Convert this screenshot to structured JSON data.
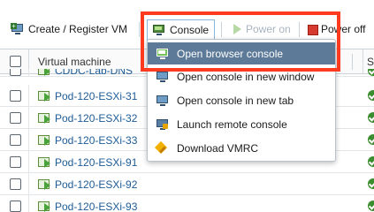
{
  "toolbar": {
    "create_label": "Create / Register VM",
    "console_label": "Console",
    "power_on_label": "Power on",
    "power_off_label": "Power off"
  },
  "grid": {
    "columns": {
      "vm": "Virtual machine",
      "status": "S"
    },
    "rows": [
      {
        "name": "CDDC-Lab-DNS",
        "status": "normal"
      },
      {
        "name": "Pod-120-ESXi-31",
        "status": "normal"
      },
      {
        "name": "Pod-120-ESXi-32",
        "status": "normal"
      },
      {
        "name": "Pod-120-ESXi-33",
        "status": "normal"
      },
      {
        "name": "Pod-120-ESXi-91",
        "status": "normal"
      },
      {
        "name": "Pod-120-ESXi-92",
        "status": "normal"
      },
      {
        "name": "Pod-120-ESXi-93",
        "status": "normal"
      }
    ]
  },
  "console_menu": {
    "items": [
      {
        "label": "Open browser console",
        "icon": "browser-console-icon",
        "active": true
      },
      {
        "label": "Open console in new window",
        "icon": "monitor-icon",
        "active": false
      },
      {
        "label": "Open console in new tab",
        "icon": "monitor-icon",
        "active": false
      },
      {
        "label": "Launch remote console",
        "icon": "remote-console-icon",
        "active": false
      },
      {
        "label": "Download VMRC",
        "icon": "vmrc-icon",
        "active": false
      }
    ]
  },
  "colors": {
    "highlight": "#ff3b1f",
    "menu_active": "#5d7b99",
    "link": "#1d5b96",
    "status_ok": "#3c8d2f"
  }
}
